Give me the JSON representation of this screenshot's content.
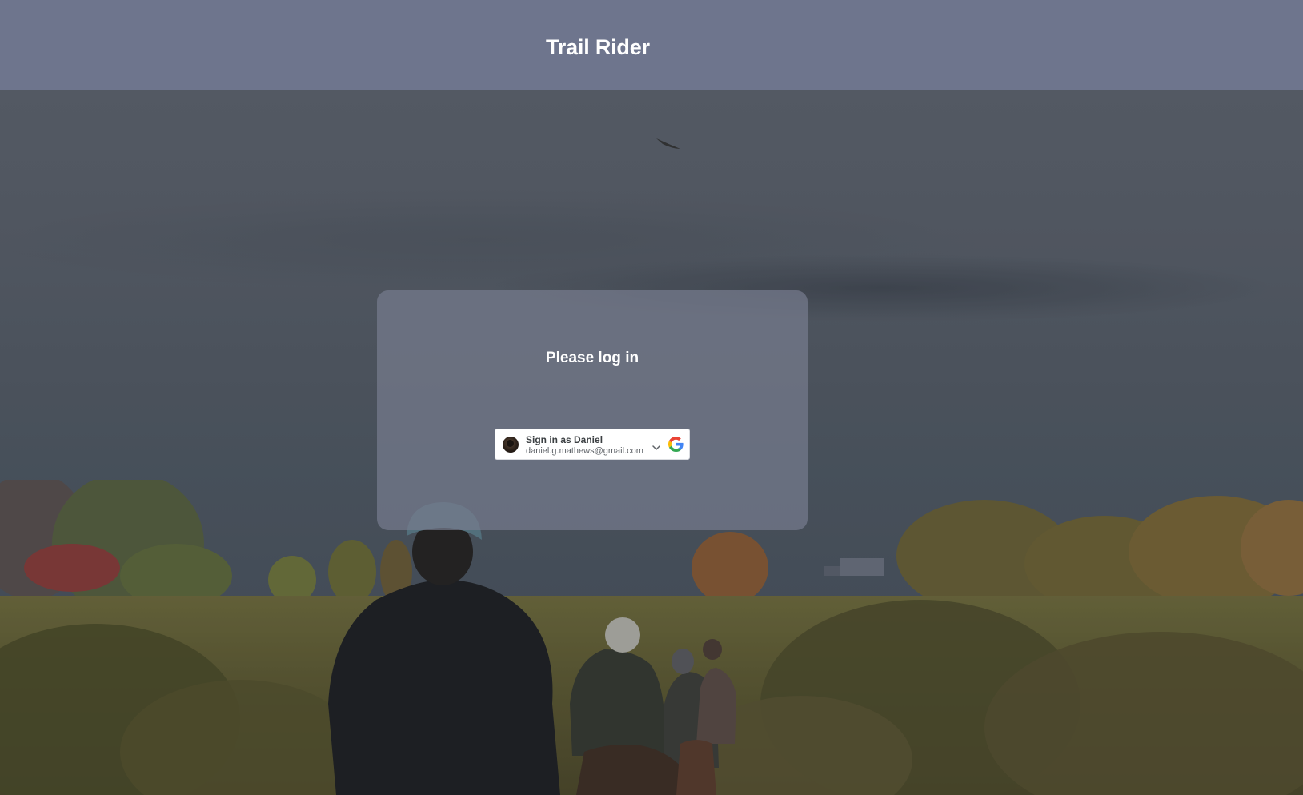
{
  "header": {
    "title": "Trail Rider"
  },
  "login": {
    "heading": "Please log in",
    "google_signin": {
      "name_label": "Sign in as Daniel",
      "email": "daniel.g.mathews@gmail.com",
      "provider_icon": "google-g-icon",
      "dropdown_icon": "chevron-down-icon"
    }
  },
  "background": {
    "description_icon": "horse-trail-photo"
  },
  "colors": {
    "header_bg": "#70768e",
    "card_bg": "#767c8e",
    "text": "#ffffff"
  }
}
